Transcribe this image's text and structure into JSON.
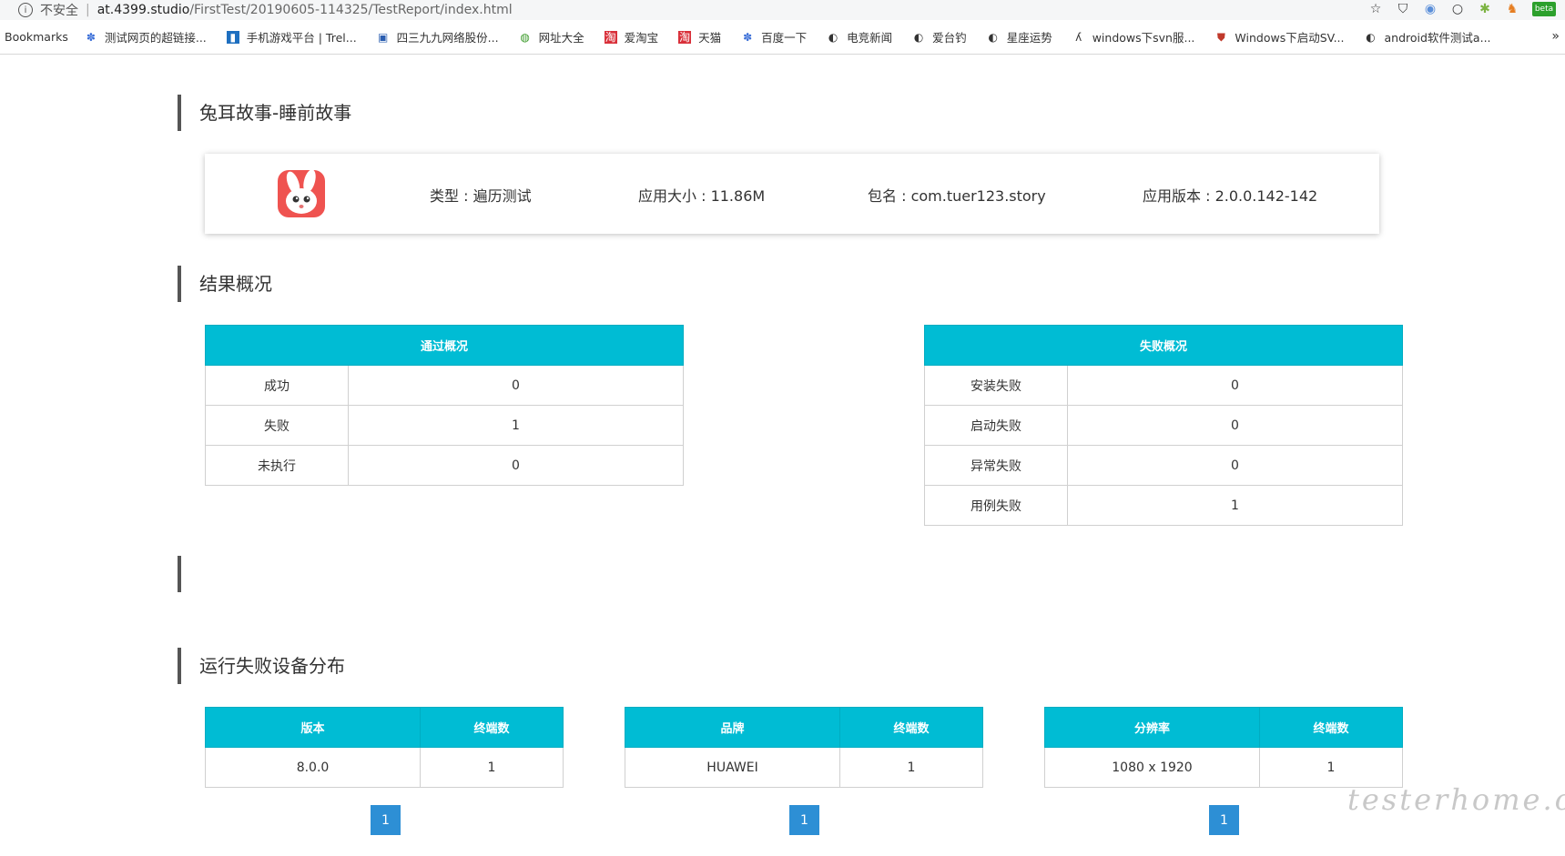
{
  "browser": {
    "insecure_label": "不安全",
    "url_host": "at.4399.studio",
    "url_path": "/FirstTest/20190605-114325/TestReport/index.html",
    "beta_label": "beta",
    "bookmarks": [
      "Bookmarks",
      "测试网页的超链接...",
      "手机游戏平台 | Trel...",
      "四三九九网络股份...",
      "网址大全",
      "爱淘宝",
      "天猫",
      "百度一下",
      "电竞新闻",
      "爱台钓",
      "星座运势",
      "windows下svn服...",
      "Windows下启动SV...",
      "android软件测试a..."
    ]
  },
  "app": {
    "title": "兔耳故事-睡前故事",
    "type_label": "类型 : 遍历测试",
    "size_label": "应用大小 : 11.86M",
    "package_label": "包名 : com.tuer123.story",
    "version_label": "应用版本 : 2.0.0.142-142"
  },
  "results": {
    "title": "结果概况",
    "pass_table": {
      "header": "通过概况",
      "rows": [
        {
          "label": "成功",
          "value": "0"
        },
        {
          "label": "失败",
          "value": "1"
        },
        {
          "label": "未执行",
          "value": "0"
        }
      ]
    },
    "fail_table": {
      "header": "失败概况",
      "rows": [
        {
          "label": "安装失败",
          "value": "0"
        },
        {
          "label": "启动失败",
          "value": "0"
        },
        {
          "label": "异常失败",
          "value": "0"
        },
        {
          "label": "用例失败",
          "value": "1"
        }
      ]
    }
  },
  "empty_section_title": "",
  "distribution": {
    "title": "运行失败设备分布",
    "tables": [
      {
        "col1": "版本",
        "col2": "终端数",
        "row": [
          "8.0.0",
          "1"
        ],
        "page": "1"
      },
      {
        "col1": "品牌",
        "col2": "终端数",
        "row": [
          "HUAWEI",
          "1"
        ],
        "page": "1"
      },
      {
        "col1": "分辨率",
        "col2": "终端数",
        "row": [
          "1080 x 1920",
          "1"
        ],
        "page": "1"
      }
    ]
  },
  "watermark": "testerhome.com",
  "colors": {
    "table_header": "#00bcd4",
    "pager": "#2d8fd5",
    "logo": "#ef5350"
  }
}
